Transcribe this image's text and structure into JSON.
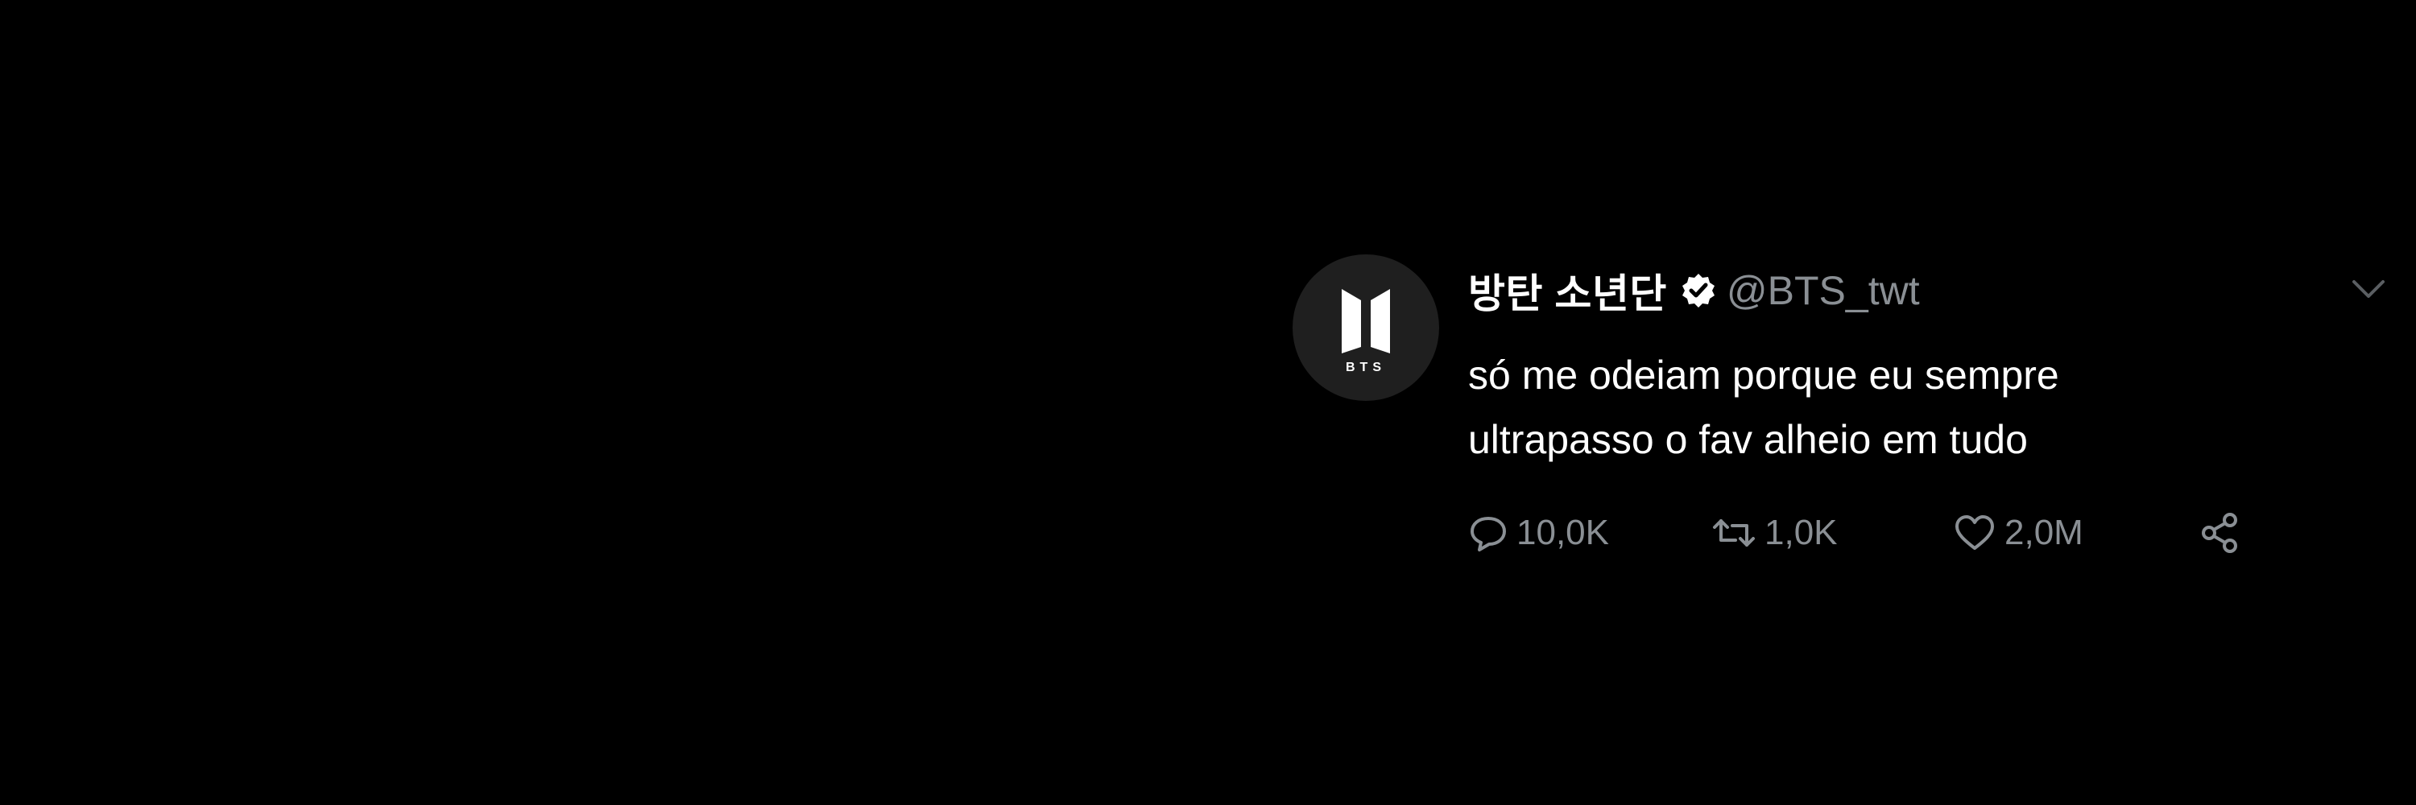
{
  "tweet": {
    "display_name": "방탄 소년단",
    "handle": "@BTS_twt",
    "avatar_text": "BTS",
    "text_lines": [
      "só me odeiam porque eu sempre",
      "ultrapasso o fav alheio em tudo"
    ],
    "actions": {
      "reply_count": "10,0K",
      "retweet_count": "1,0K",
      "like_count": "2,0M"
    }
  },
  "icons": {
    "verified": "verified-badge-icon",
    "caret": "chevron-down-icon",
    "reply": "speech-bubble-icon",
    "retweet": "retweet-arrows-icon",
    "like": "heart-icon",
    "share": "share-nodes-icon"
  },
  "colors": {
    "background": "#000000",
    "text_primary": "#ffffff",
    "text_secondary": "#8a8f94",
    "avatar_bg": "#1f1f1f"
  }
}
